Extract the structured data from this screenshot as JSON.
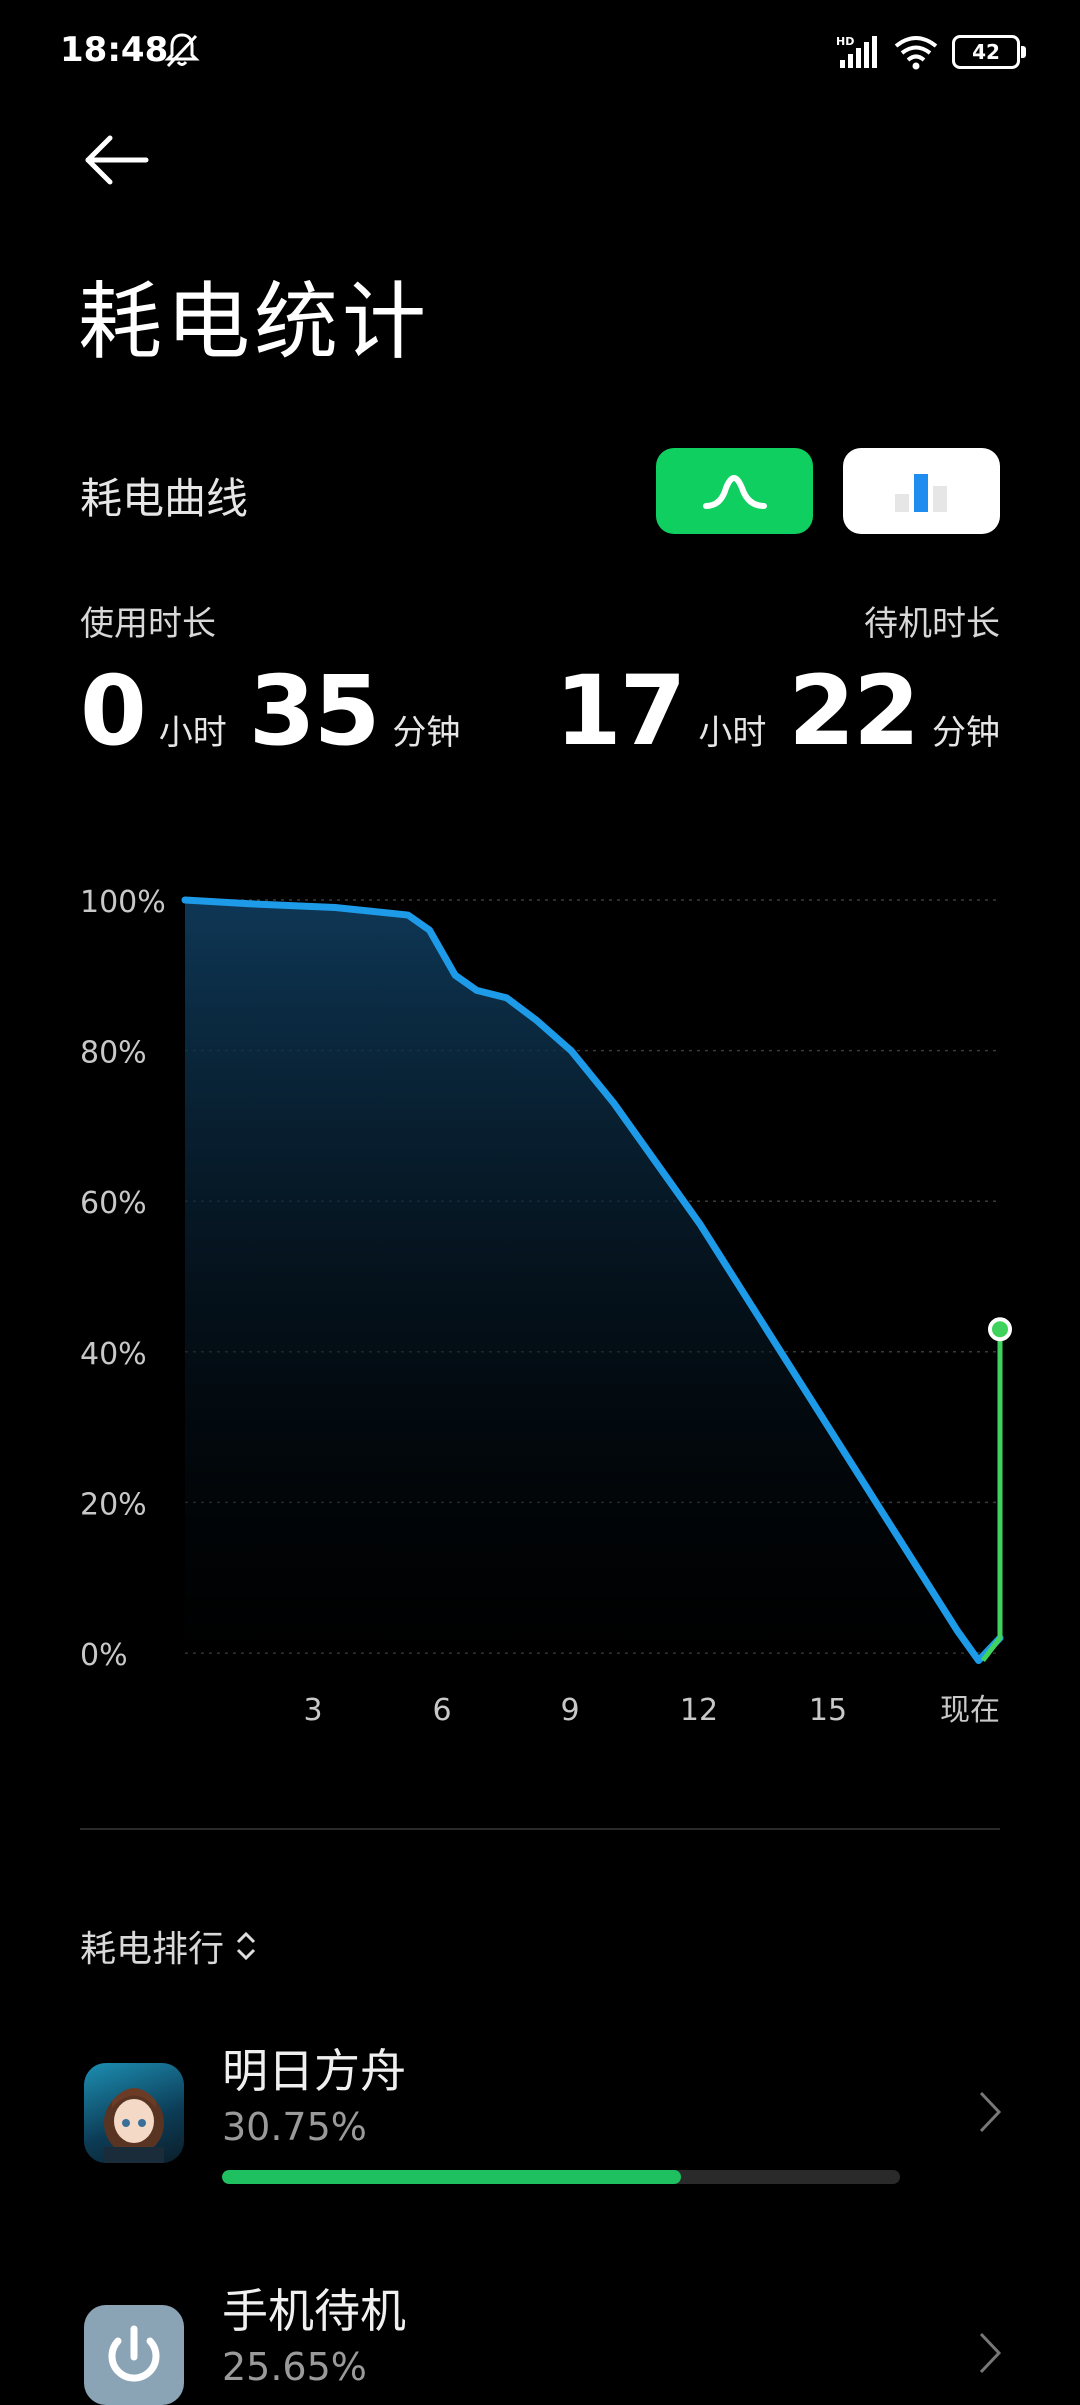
{
  "status_bar": {
    "time": "18:48",
    "network": "HD",
    "battery": "42"
  },
  "header": {
    "title": "耗电统计"
  },
  "curve_section": {
    "label": "耗电曲线"
  },
  "usage": {
    "label": "使用时长",
    "hours": "0",
    "hours_unit": "小时",
    "minutes": "35",
    "minutes_unit": "分钟"
  },
  "standby": {
    "label": "待机时长",
    "hours": "17",
    "hours_unit": "小时",
    "minutes": "22",
    "minutes_unit": "分钟"
  },
  "chart_data": {
    "type": "line",
    "y_ticks": [
      "100%",
      "80%",
      "60%",
      "40%",
      "20%",
      "0%"
    ],
    "x_ticks": [
      "3",
      "6",
      "9",
      "12",
      "15",
      "现在"
    ],
    "ylim": [
      0,
      100
    ],
    "xlim": [
      0,
      19
    ],
    "grid": true,
    "series": [
      {
        "color": "#1e9be8",
        "x": [
          0,
          1.5,
          3.5,
          5.2,
          5.7,
          6.3,
          6.8,
          7.5,
          8.2,
          9.0,
          10.0,
          11.0,
          12.0,
          13.0,
          14.0,
          15.0,
          16.0,
          17.0,
          18.0,
          18.5,
          19.0
        ],
        "y": [
          100,
          99.5,
          99,
          98,
          96,
          90,
          88,
          87,
          84,
          80,
          73,
          65,
          57,
          48,
          39,
          30,
          21,
          12,
          3,
          -1,
          2
        ]
      },
      {
        "color": "#3fd35d",
        "x": [
          18.6,
          19.0,
          19.0
        ],
        "y": [
          -1,
          2,
          43
        ]
      }
    ],
    "end_point": {
      "x": 19.0,
      "y": 43
    }
  },
  "ranking": {
    "label": "耗电排行",
    "items": [
      {
        "name": "明日方舟",
        "percent": "30.75%",
        "fraction": 0.3075
      },
      {
        "name": "手机待机",
        "percent": "25.65%",
        "fraction": 0.2565
      }
    ]
  },
  "colors": {
    "accent_green": "#0fcf60",
    "line_blue": "#1e9be8"
  },
  "icons": [
    "back-arrow-icon",
    "bell-off-icon",
    "signal-icon",
    "wifi-icon",
    "battery-icon",
    "curve-icon",
    "bar-chart-icon",
    "sort-icon",
    "chevron-right-icon",
    "power-icon"
  ]
}
